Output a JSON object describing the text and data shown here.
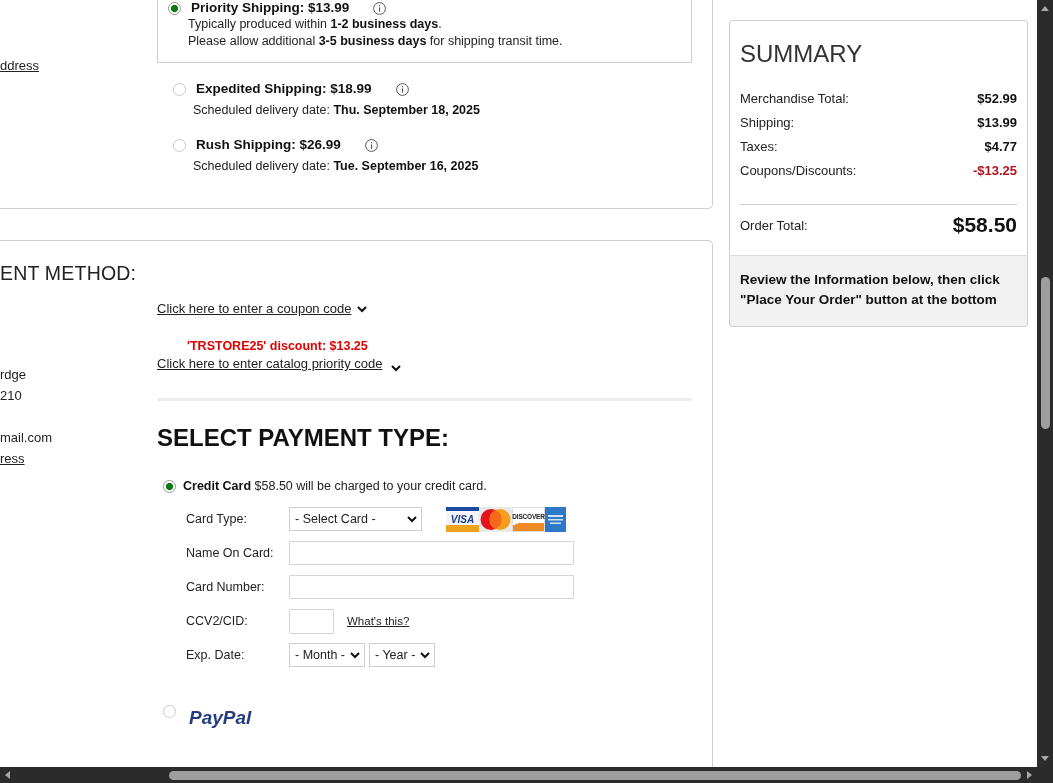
{
  "shipping": {
    "side_link": "ddress",
    "options": [
      {
        "label": "Priority Shipping: $13.99",
        "selected": true,
        "details": [
          "Typically produced within **1-2 business days**.",
          "Please allow additional **3-5 business days** for shipping transit time."
        ]
      },
      {
        "label": "Expedited Shipping: $18.99",
        "selected": false,
        "details": [
          "Scheduled delivery date: **Thu. September 18, 2025**"
        ]
      },
      {
        "label": "Rush Shipping: $26.99",
        "selected": false,
        "details": [
          "Scheduled delivery date: **Tue. September 16, 2025**"
        ]
      }
    ]
  },
  "payment": {
    "heading": "ENT METHOD:",
    "side_groups": [
      {
        "lines": [
          "rdge",
          "210"
        ]
      },
      {
        "lines": [
          "mail.com"
        ],
        "link": "ress"
      }
    ],
    "coupon_link": "Click here to enter a coupon code",
    "discount_note": "'TRSTORE25' discount: $13.25",
    "catalog_link": "Click here to enter catalog priority code",
    "type_heading": "SELECT PAYMENT TYPE:",
    "methods": [
      {
        "kind": "card",
        "selected": true,
        "label": "**Credit Card** $58.50 will be charged to your credit card.",
        "fields": [
          {
            "kind": "select",
            "label": "Card Type:",
            "value": "- Select Card -",
            "logos": [
              {
                "kind": "visa",
                "text": "VISA"
              },
              {
                "kind": "circles"
              },
              {
                "kind": "discover",
                "text": "DISCOVER"
              },
              {
                "kind": "stripes"
              }
            ]
          },
          {
            "kind": "text",
            "label": "Name On Card:"
          },
          {
            "kind": "text",
            "label": "Card Number:"
          },
          {
            "kind": "code",
            "label": "CCV2/CID:",
            "link": "What's this?"
          },
          {
            "kind": "date",
            "label": "Exp. Date:",
            "values": [
              "- Month -",
              "- Year -"
            ]
          }
        ]
      },
      {
        "kind": "paypal",
        "selected": false,
        "logo": "PayPal"
      }
    ]
  },
  "summary": {
    "title": "SUMMARY",
    "rows": [
      {
        "label": "Merchandise Total:",
        "value": "$52.99",
        "kind": "charge"
      },
      {
        "label": "Shipping:",
        "value": "$13.99",
        "kind": "charge"
      },
      {
        "label": "Taxes:",
        "value": "$4.77",
        "kind": "charge"
      },
      {
        "label": "Coupons/Discounts:",
        "value": "-$13.25",
        "kind": "discount"
      }
    ],
    "total": {
      "label": "Order Total:",
      "value": "$58.50"
    },
    "note": "Review the Information below, then click \"Place Your Order\" button at the bottom"
  }
}
